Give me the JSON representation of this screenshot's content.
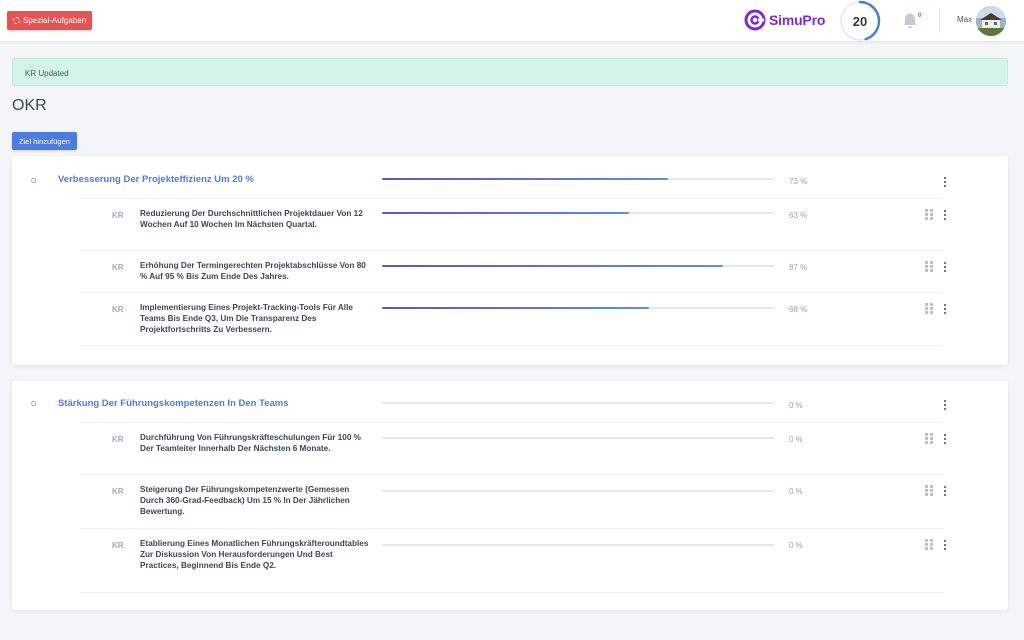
{
  "header": {
    "special_button": "Spezial-Aufgaben",
    "logo_text": "SimuPro",
    "score": "20",
    "score_progress": 0.45,
    "notification_badge": "0",
    "user_name": "Max"
  },
  "alert": {
    "text": "KR Updated"
  },
  "page": {
    "title": "OKR",
    "add_button": "Ziel hinzufügen"
  },
  "objectives": [
    {
      "tag": "O",
      "title": "Verbesserung Der Projekteffizienz Um 20 %",
      "progress": 73,
      "percent": "73 %",
      "key_results": [
        {
          "tag": "KR",
          "title": "Reduzierung Der Durchschnittlichen Projektdauer Von 12 Wochen Auf 10 Wochen Im Nächsten Quartal.",
          "progress": 63,
          "percent": "63 %"
        },
        {
          "tag": "KR",
          "title": "Erhöhung Der Termingerechten Projektabschlüsse Von 80 % Auf 95 % Bis Zum Ende Des Jahres.",
          "progress": 87,
          "percent": "87 %"
        },
        {
          "tag": "KR",
          "title": "Implementierung Eines Projekt-Tracking-Tools Für Alle Teams Bis Ende Q3, Um Die Transparenz Des Projektfortschritts Zu Verbessern.",
          "progress": 68,
          "percent": "68 %"
        }
      ]
    },
    {
      "tag": "O",
      "title": "Stärkung Der Führungskompetenzen In Den Teams",
      "progress": 0,
      "percent": "0 %",
      "key_results": [
        {
          "tag": "KR",
          "title": "Durchführung Von Führungskräfteschulungen Für 100 % Der Teamleiter Innerhalb Der Nächsten 6 Monate.",
          "progress": 0,
          "percent": "0 %"
        },
        {
          "tag": "KR",
          "title": "Steigerung Der Führungskompetenzwerte (Gemessen Durch 360-Grad-Feedback) Um 15 % In Der Jährlichen Bewertung.",
          "progress": 0,
          "percent": "0 %"
        },
        {
          "tag": "KR",
          "title": "Etablierung Eines Monatlichen Führungskräfteroundtables Zur Diskussion Von Herausforderungen Und Best Practices, Beginnend Bis Ende Q2.",
          "progress": 0,
          "percent": "0 %"
        }
      ]
    }
  ],
  "colors": {
    "primary": "#4d7bdf",
    "danger": "#e55353",
    "brand": "#7b2bd9",
    "success_bg": "#d4f4e8"
  },
  "icons": {
    "spinner": "spinner-icon",
    "bell": "bell-icon",
    "kebab": "kebab-menu-icon",
    "grip": "drag-handle-icon"
  }
}
